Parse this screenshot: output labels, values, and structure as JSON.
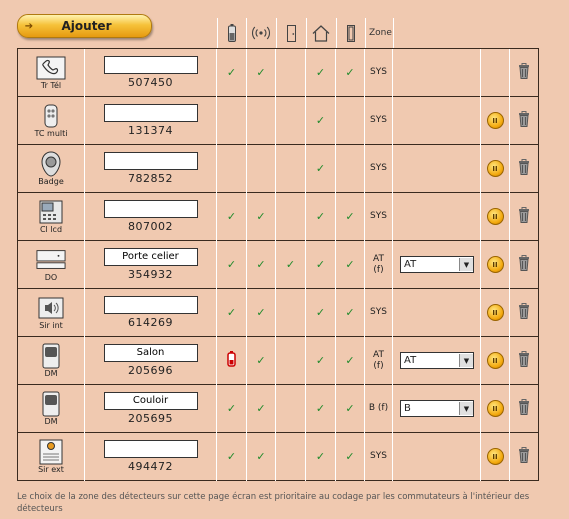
{
  "toolbar": {
    "add_label": "Ajouter"
  },
  "header": {
    "zone_label": "Zone",
    "column_icons": [
      "battery-icon",
      "radio-signal-icon",
      "door-icon",
      "house-icon",
      "window-icon"
    ]
  },
  "devices": [
    {
      "type": "Tr Tél",
      "icon": "phone-transmitter-icon",
      "name": "",
      "code": "507450",
      "checks": [
        true,
        true,
        false,
        true,
        true
      ],
      "battery_alert": false,
      "zone": "SYS",
      "select": null,
      "pause": false
    },
    {
      "type": "TC multi",
      "icon": "remote-control-icon",
      "name": "",
      "code": "131374",
      "checks": [
        false,
        false,
        false,
        true,
        false
      ],
      "battery_alert": false,
      "zone": "SYS",
      "select": null,
      "pause": true
    },
    {
      "type": "Badge",
      "icon": "badge-icon",
      "name": "",
      "code": "782852",
      "checks": [
        false,
        false,
        false,
        true,
        false
      ],
      "battery_alert": false,
      "zone": "SYS",
      "select": null,
      "pause": true
    },
    {
      "type": "Cl lcd",
      "icon": "lcd-keypad-icon",
      "name": "",
      "code": "807002",
      "checks": [
        true,
        true,
        false,
        true,
        true
      ],
      "battery_alert": false,
      "zone": "SYS",
      "select": null,
      "pause": true
    },
    {
      "type": "DO",
      "icon": "opening-detector-icon",
      "name": "Porte celier",
      "code": "354932",
      "checks": [
        true,
        true,
        true,
        true,
        true
      ],
      "battery_alert": false,
      "zone": "AT (f)",
      "select": "AT",
      "pause": true
    },
    {
      "type": "Sir int",
      "icon": "indoor-siren-icon",
      "name": "",
      "code": "614269",
      "checks": [
        true,
        true,
        false,
        true,
        true
      ],
      "battery_alert": false,
      "zone": "SYS",
      "select": null,
      "pause": true
    },
    {
      "type": "DM",
      "icon": "motion-detector-icon",
      "name": "Salon",
      "code": "205696",
      "checks": [
        false,
        true,
        false,
        true,
        true
      ],
      "battery_alert": true,
      "zone": "AT (f)",
      "select": "AT",
      "pause": true
    },
    {
      "type": "DM",
      "icon": "motion-detector-icon",
      "name": "Couloir",
      "code": "205695",
      "checks": [
        true,
        true,
        false,
        true,
        true
      ],
      "battery_alert": false,
      "zone": "B (f)",
      "select": "B",
      "pause": true
    },
    {
      "type": "Sir ext",
      "icon": "outdoor-siren-icon",
      "name": "",
      "code": "494472",
      "checks": [
        true,
        true,
        false,
        true,
        true
      ],
      "battery_alert": false,
      "zone": "SYS",
      "select": null,
      "pause": true
    }
  ],
  "footnote": "Le choix de la zone des détecteurs sur cette page écran est prioritaire au codage par les commutateurs à l'intérieur des détecteurs"
}
